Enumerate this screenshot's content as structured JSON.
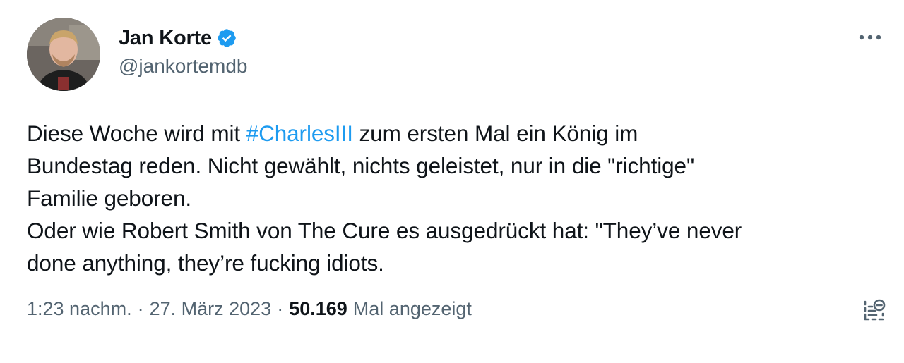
{
  "tweet": {
    "author": {
      "name": "Jan Korte",
      "handle": "@jankortemdb",
      "verified": true
    },
    "text_part1": "Diese Woche wird mit ",
    "hashtag": "#CharlesIII",
    "text_part2": " zum ersten Mal ein König im\nBundestag reden. Nicht gewählt, nichts geleistet, nur in die \"richtige\"\nFamilie geboren.\nOder wie Robert Smith von The Cure es ausgedrückt hat: \"They’ve never\ndone anything, they’re fucking idiots.",
    "meta": {
      "time": "1:23 nachm.",
      "separator1": "·",
      "date": "27. März 2023",
      "separator2": "·",
      "views_count": "50.169",
      "views_label": "Mal angezeigt"
    },
    "icons": {
      "more": "more-dots-icon",
      "analytics": "analytics-icon",
      "verified": "verified-badge-icon"
    },
    "colors": {
      "accent": "#1d9bf0",
      "text": "#0f1419",
      "secondary": "#536471"
    }
  }
}
